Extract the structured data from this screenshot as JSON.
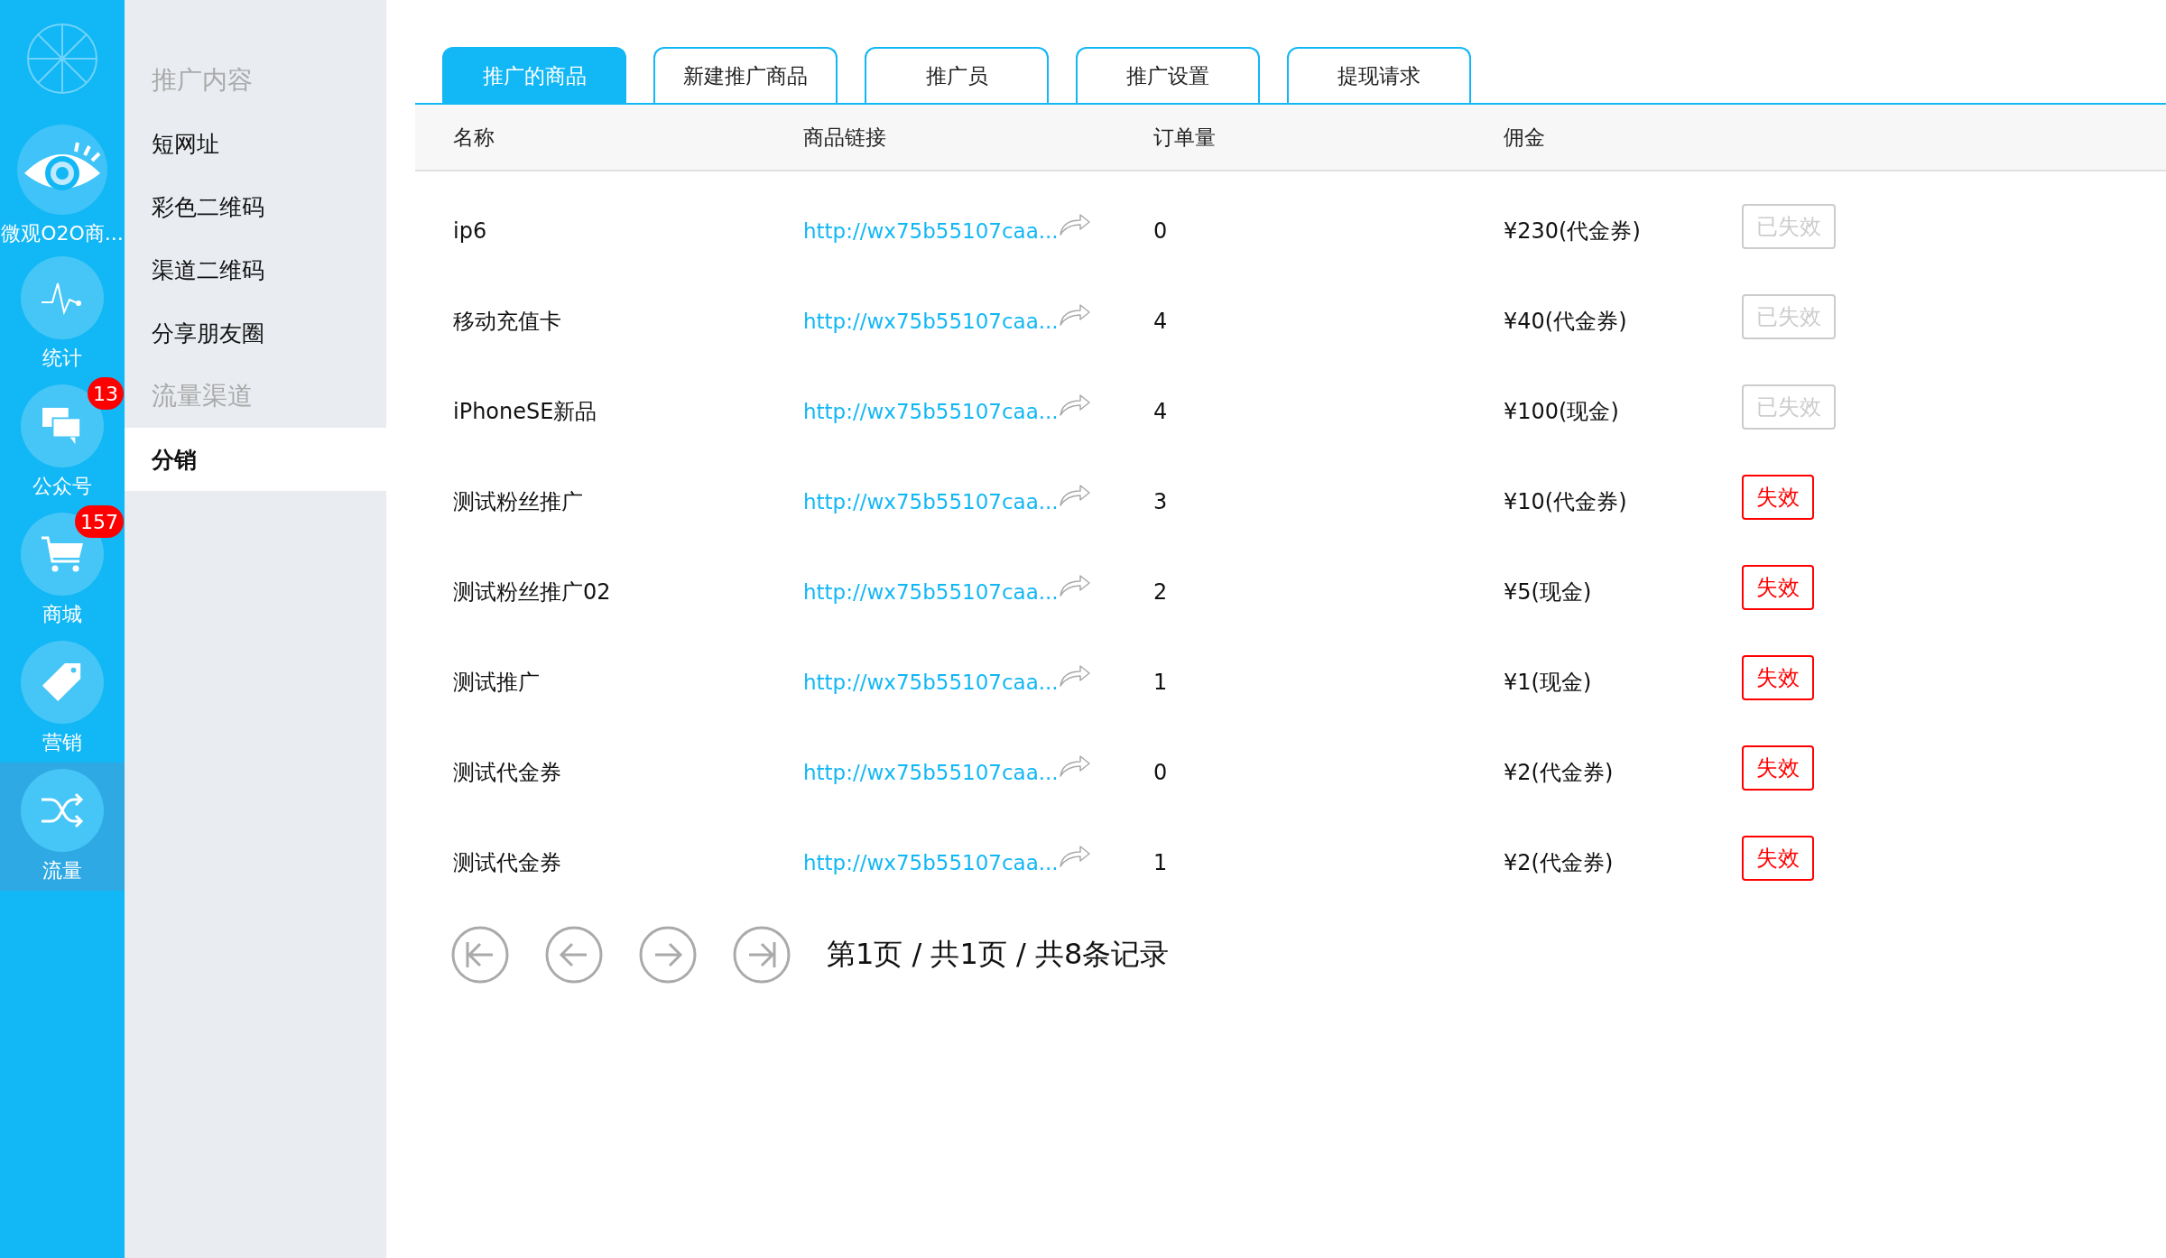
{
  "app_bar": {
    "items": [
      {
        "label": "微观O2O商...",
        "selected": false
      },
      {
        "label": "统计",
        "selected": false
      },
      {
        "label": "公众号",
        "selected": false,
        "badge": "13"
      },
      {
        "label": "商城",
        "selected": false,
        "badge": "157"
      },
      {
        "label": "营销",
        "selected": false
      },
      {
        "label": "流量",
        "selected": true
      }
    ]
  },
  "submenu": [
    {
      "label": "推广内容",
      "kind": "heading"
    },
    {
      "label": "短网址",
      "kind": "link",
      "selected": false
    },
    {
      "label": "彩色二维码",
      "kind": "link",
      "selected": false
    },
    {
      "label": "渠道二维码",
      "kind": "link",
      "selected": false
    },
    {
      "label": "分享朋友圈",
      "kind": "link",
      "selected": false
    },
    {
      "label": "流量渠道",
      "kind": "heading"
    },
    {
      "label": "分销",
      "kind": "link",
      "selected": true
    }
  ],
  "tabs": [
    {
      "label": "推广的商品",
      "selected": true
    },
    {
      "label": "新建推广商品",
      "selected": false
    },
    {
      "label": "推广员",
      "selected": false
    },
    {
      "label": "推广设置",
      "selected": false
    },
    {
      "label": "提现请求",
      "selected": false
    }
  ],
  "table": {
    "columns": [
      "名称",
      "商品链接",
      "订单量",
      "佣金"
    ],
    "rows": [
      {
        "name": "ip6",
        "link": "http://wx75b55107caa...",
        "orders": "0",
        "commission": "¥230(代金券)",
        "status": {
          "label": "已失效",
          "disabled": true
        }
      },
      {
        "name": "移动充值卡",
        "link": "http://wx75b55107caa...",
        "orders": "4",
        "commission": "¥40(代金券)",
        "status": {
          "label": "已失效",
          "disabled": true
        }
      },
      {
        "name": "iPhoneSE新品",
        "link": "http://wx75b55107caa...",
        "orders": "4",
        "commission": "¥100(现金)",
        "status": {
          "label": "已失效",
          "disabled": true
        }
      },
      {
        "name": "测试粉丝推广",
        "link": "http://wx75b55107caa...",
        "orders": "3",
        "commission": "¥10(代金券)",
        "status": {
          "label": "失效",
          "disabled": false
        }
      },
      {
        "name": "测试粉丝推广02",
        "link": "http://wx75b55107caa...",
        "orders": "2",
        "commission": "¥5(现金)",
        "status": {
          "label": "失效",
          "disabled": false
        }
      },
      {
        "name": "测试推广",
        "link": "http://wx75b55107caa...",
        "orders": "1",
        "commission": "¥1(现金)",
        "status": {
          "label": "失效",
          "disabled": false
        }
      },
      {
        "name": "测试代金券",
        "link": "http://wx75b55107caa...",
        "orders": "0",
        "commission": "¥2(代金券)",
        "status": {
          "label": "失效",
          "disabled": false
        }
      },
      {
        "name": "测试代金券",
        "link": "http://wx75b55107caa...",
        "orders": "1",
        "commission": "¥2(代金券)",
        "status": {
          "label": "失效",
          "disabled": false
        }
      }
    ]
  },
  "pagination": {
    "summary": "第1页 / 共1页 / 共8条记录"
  }
}
